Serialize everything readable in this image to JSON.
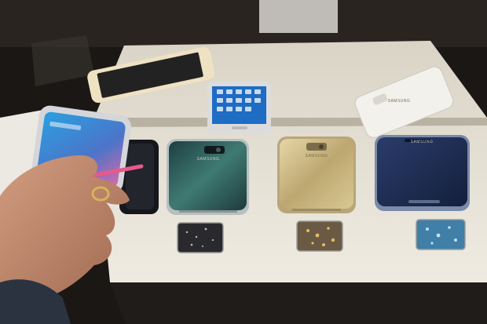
{
  "scene": {
    "description_free": true,
    "palette": {
      "background": "#1a1715",
      "table": "#e8e3d6",
      "tray_shadow": "#b9b2a2",
      "skin": "#c08a6e",
      "sleeve": "#2b3340",
      "green_phone": "#2e5a58",
      "gold_phone": "#c9b680",
      "blue_phone": "#1f2e52",
      "black_phone": "#1a1c22",
      "white_phone": "#f1efe9"
    },
    "phone_brand_marks": [
      {
        "id": "green",
        "text": "SAMSUNG"
      },
      {
        "id": "gold",
        "text": "SAMSUNG"
      },
      {
        "id": "blue",
        "text": "SAMSUNG"
      },
      {
        "id": "white",
        "text": "SAMSUNG"
      }
    ],
    "samples": [
      "black-glitter",
      "gold-glitter",
      "blue-glitter"
    ]
  }
}
